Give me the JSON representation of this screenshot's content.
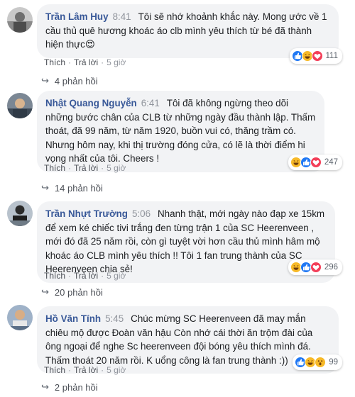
{
  "comments": [
    {
      "author": "Trần Lâm Huy",
      "time": "8:41",
      "text": "Tôi sẽ nhớ khoảnh khắc này. Mong ước về 1 cầu thủ quê hương khoác áo clb mình yêu thích từ bé đã thành hiện thực😍",
      "reaction_count": "111",
      "reactions": [
        "like-icon",
        "haha-icon",
        "love-icon"
      ],
      "like_label": "Thích",
      "reply_label": "Trả lời",
      "ago": "5 giờ",
      "replies": "4 phản hồi"
    },
    {
      "author": "Nhật Quang Nguyễn",
      "time": "6:41",
      "text": "Tôi đã không ngừng theo dõi những bước chân của CLB từ những ngày đầu thành lập. Thấm thoát, đã 99 năm, từ năm 1920, buồn vui có, thăng trầm có. Nhưng hôm nay, khi thị trường đóng cửa, có lẽ là thời điểm hi vọng nhất của tôi. Cheers !",
      "reaction_count": "247",
      "reactions": [
        "haha-icon",
        "like-icon",
        "love-icon"
      ],
      "like_label": "Thích",
      "reply_label": "Trả lời",
      "ago": "5 giờ",
      "replies": "14 phản hồi"
    },
    {
      "author": "Trần Nhựt Trường",
      "time": "5:06",
      "text": "Nhanh thật, mới ngày nào đạp xe 15km để xem ké chiếc tivi trắng đen từng trận 1 của SC Heerenveen , mới đó đã 25 năm rồi, còn gì tuyệt vời hơn cầu thủ mình hâm mộ khoác áo CLB mình yêu thích !! Tôi 1 fan trung thành của SC Heerenveen chia sẻ!",
      "reaction_count": "296",
      "reactions": [
        "haha-icon",
        "like-icon",
        "love-icon"
      ],
      "like_label": "Thích",
      "reply_label": "Trả lời",
      "ago": "5 giờ",
      "replies": "20 phản hồi"
    },
    {
      "author": "Hồ Văn Tính",
      "time": "5:45",
      "text": "Chúc mừng SC Heerenveen đã may mắn chiêu mộ được Đoàn văn hậu Còn nhớ cái thời ăn trộm đài của ông ngoại để nghe Sc heerenveen đội bóng yêu thích mình đá. Thấm thoát 20 năm rồi. K uổng công là fan trung thành :))",
      "reaction_count": "99",
      "reactions": [
        "like-icon",
        "haha-icon",
        "wow-icon"
      ],
      "like_label": "Thích",
      "reply_label": "Trả lời",
      "ago": "5 giờ",
      "replies": "2 phản hồi"
    }
  ],
  "colors": {
    "author": "#385898",
    "bubble": "#f2f3f5",
    "like": "#2078f4",
    "love": "#f33e58",
    "haha": "#f7b928"
  }
}
